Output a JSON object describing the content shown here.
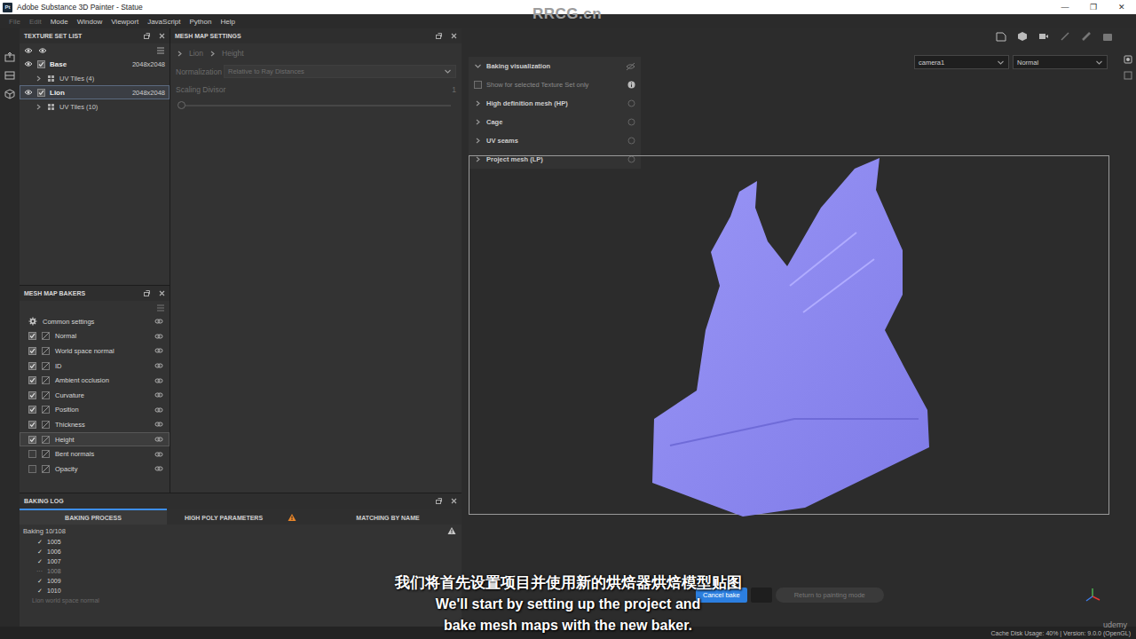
{
  "window": {
    "app_icon": "Pt",
    "title": "Adobe Substance 3D Painter - Statue",
    "controls": [
      "—",
      "❐",
      "✕"
    ]
  },
  "menu": [
    {
      "label": "File",
      "disabled": true
    },
    {
      "label": "Edit",
      "disabled": true
    },
    {
      "label": "Mode",
      "disabled": false
    },
    {
      "label": "Window",
      "disabled": false
    },
    {
      "label": "Viewport",
      "disabled": false
    },
    {
      "label": "JavaScript",
      "disabled": false
    },
    {
      "label": "Python",
      "disabled": false
    },
    {
      "label": "Help",
      "disabled": false
    }
  ],
  "texture_set_list": {
    "title": "TEXTURE SET LIST",
    "items": [
      {
        "name": "Base",
        "size": "2048x2048",
        "visible": true,
        "checked": true,
        "selected": false,
        "tiles": {
          "label": "UV Tiles (4)",
          "expanded": false
        }
      },
      {
        "name": "Lion",
        "size": "2048x2048",
        "visible": true,
        "checked": true,
        "selected": true,
        "tiles": {
          "label": "UV Tiles (10)",
          "expanded": false
        }
      }
    ]
  },
  "mesh_map_settings": {
    "title": "MESH MAP SETTINGS",
    "breadcrumb": [
      "Lion",
      "Height"
    ],
    "normalization": {
      "label": "Normalization",
      "value": "Relative to Ray Distances"
    },
    "scaling_divisor": {
      "label": "Scaling Divisor",
      "value": "1",
      "level": 0
    }
  },
  "mesh_map_bakers": {
    "title": "MESH MAP BAKERS",
    "common": "Common settings",
    "items": [
      {
        "label": "Normal",
        "checked": true,
        "selected": false
      },
      {
        "label": "World space normal",
        "checked": true,
        "selected": false
      },
      {
        "label": "ID",
        "checked": true,
        "selected": false
      },
      {
        "label": "Ambient occlusion",
        "checked": true,
        "selected": false
      },
      {
        "label": "Curvature",
        "checked": true,
        "selected": false
      },
      {
        "label": "Position",
        "checked": true,
        "selected": false
      },
      {
        "label": "Thickness",
        "checked": true,
        "selected": false
      },
      {
        "label": "Height",
        "checked": true,
        "selected": true
      },
      {
        "label": "Bent normals",
        "checked": false,
        "selected": false
      },
      {
        "label": "Opacity",
        "checked": false,
        "selected": false
      }
    ]
  },
  "baking_log": {
    "title": "BAKING LOG",
    "tabs": [
      {
        "label": "BAKING PROCESS",
        "selected": true,
        "warning": false
      },
      {
        "label": "HIGH POLY PARAMETERS",
        "selected": false,
        "warning": true
      },
      {
        "label": "MATCHING BY NAME",
        "selected": false,
        "warning": false
      }
    ],
    "progress": "Baking 10/108",
    "progress_warning": true,
    "entries": [
      {
        "tile": "1005",
        "mark": "✓",
        "done": true
      },
      {
        "tile": "1006",
        "mark": "✓",
        "done": true
      },
      {
        "tile": "1007",
        "mark": "✓",
        "done": true
      },
      {
        "tile": "1008",
        "mark": "···",
        "done": false
      },
      {
        "tile": "1009",
        "mark": "✓",
        "done": true
      },
      {
        "tile": "1010",
        "mark": "✓",
        "done": true
      }
    ],
    "footer": "Lion world space normal"
  },
  "viewport": {
    "camera": "camera1",
    "channel": "Normal",
    "visualization": {
      "title": "Baking visualization",
      "expanded": true,
      "show_selected": {
        "label": "Show for selected Texture Set only",
        "checked": false
      },
      "sections": [
        {
          "label": "High definition mesh (HP)",
          "expanded": false
        },
        {
          "label": "Cage",
          "expanded": false
        },
        {
          "label": "UV seams",
          "expanded": false
        },
        {
          "label": "Project mesh (LP)",
          "expanded": false
        }
      ]
    },
    "buttons": [
      {
        "label": "Cancel bake",
        "primary": true
      },
      {
        "label": "Return to painting mode",
        "primary": false
      }
    ]
  },
  "status_bar": "Cache Disk Usage:  40% | Version: 9.0.0 (OpenGL)",
  "subtitles": {
    "zh": "我们将首先设置项目并使用新的烘焙器烘焙模型贴图",
    "en": [
      "We'll start by setting up the project and",
      "bake mesh maps with the new baker."
    ]
  },
  "watermarks": {
    "site": "RRCG.cn",
    "udemy": "udemy"
  }
}
